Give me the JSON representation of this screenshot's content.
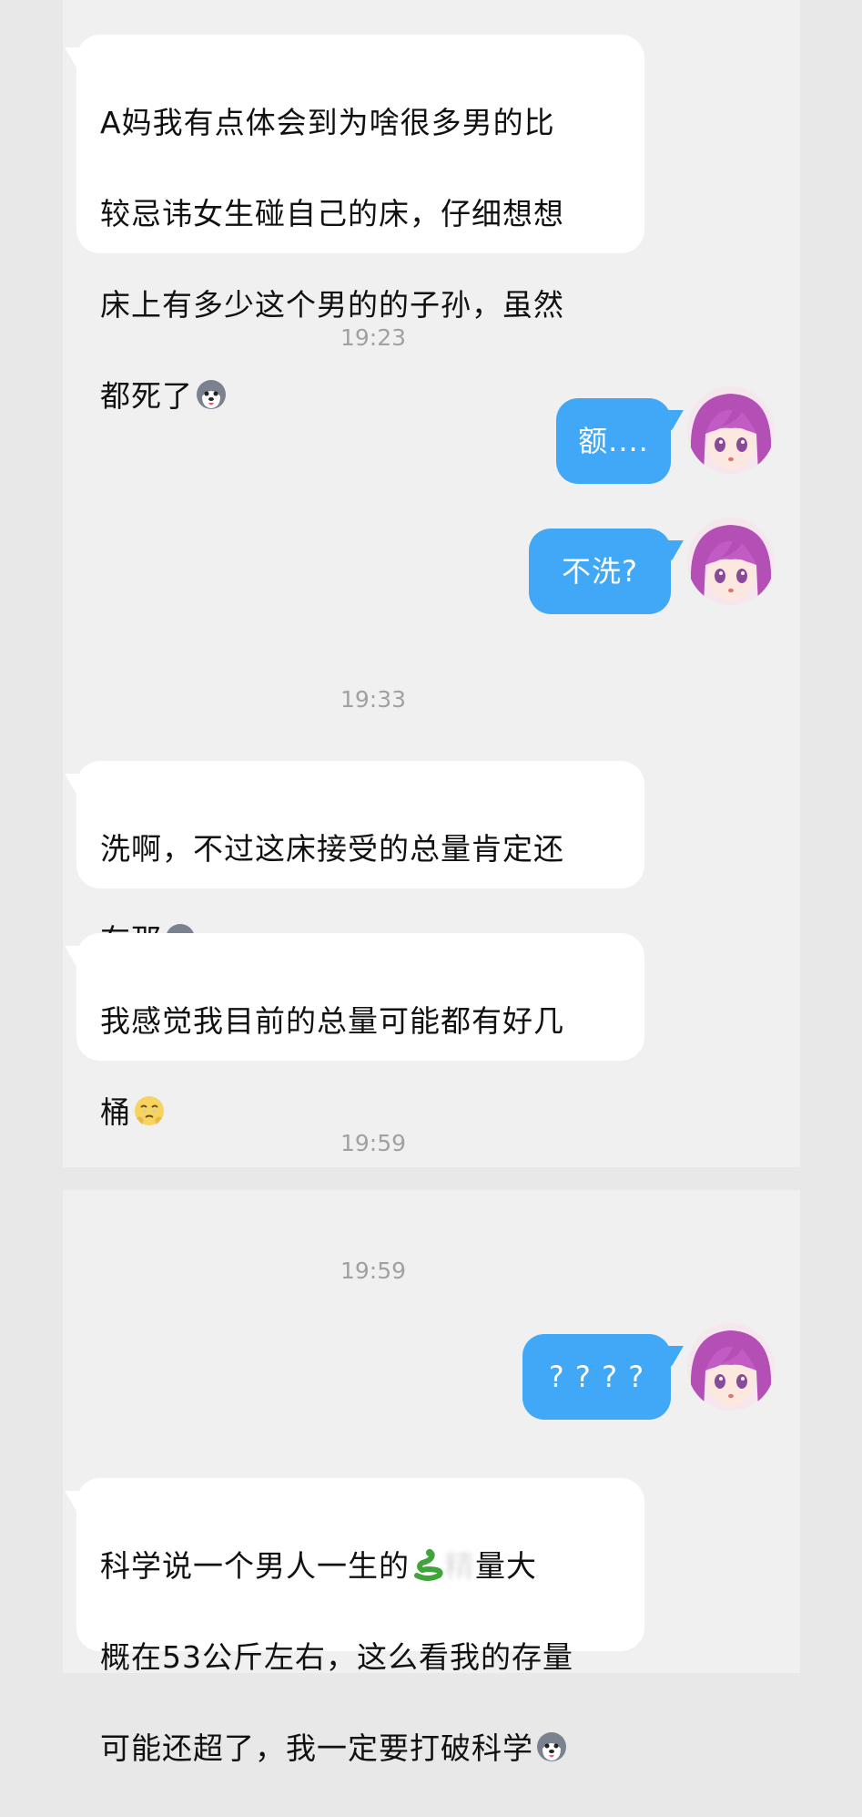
{
  "messages": [
    {
      "lines": [
        "A妈我有点体会到为啥很多男的比",
        "较忌讳女生碰自己的床，仔细想想",
        "床上有多少这个男的的子孙，虽然",
        "都死了"
      ],
      "emoji": "husky-face-emoji"
    },
    {
      "time": "19:23"
    },
    {
      "out": "额...."
    },
    {
      "out": "不洗?"
    },
    {
      "time": "19:33"
    },
    {
      "lines": [
        "洗啊，不过这床接受的总量肯定还",
        "在那"
      ],
      "emoji": "husky-face-emoji"
    },
    {
      "lines": [
        "我感觉我目前的总量可能都有好几",
        "桶"
      ],
      "emoji": "holding-back-tears-emoji"
    },
    {
      "time": "19:59"
    },
    {
      "time": "19:59"
    },
    {
      "out": "? ? ? ?"
    },
    {
      "lines": [
        "科学说一个男人一生的",
        "概在53公斤左右，这么看我的存量",
        "可能还超了，我一定要打破科学"
      ],
      "emoji": "husky-face-emoji",
      "snake_emoji": "snake-emoji",
      "line1_tail": "量大",
      "blurred": "精"
    }
  ],
  "colors": {
    "outgoing_bubble": "#41a8f7",
    "incoming_bubble": "#ffffff",
    "timestamp": "#a1a1a1",
    "background": "#e8e8e8",
    "panel": "#f0f0f0"
  }
}
